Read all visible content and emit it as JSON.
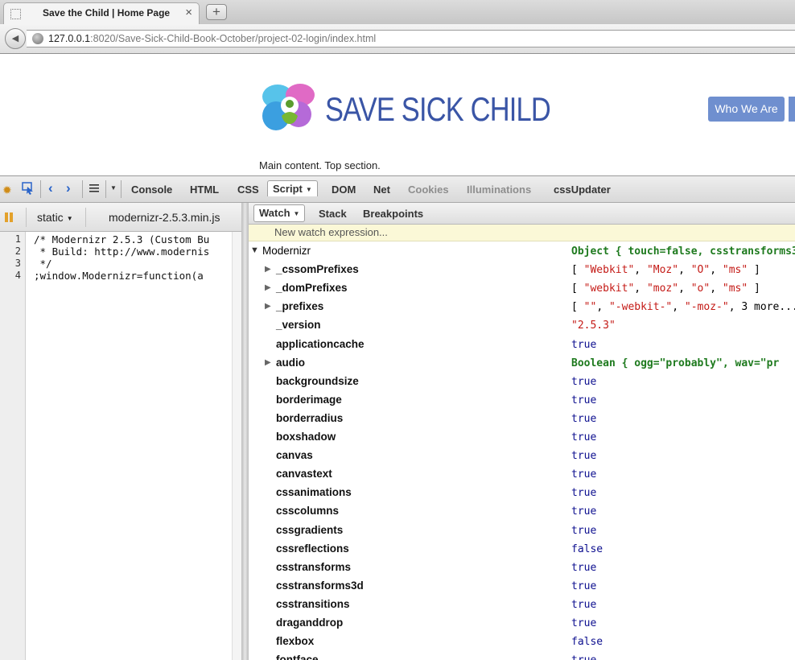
{
  "browser": {
    "tab_title": "Save the Child | Home Page",
    "tab_close": "×",
    "new_tab": "+",
    "back_glyph": "◀",
    "url_host": "127.0.0.1",
    "url_rest": ":8020/Save-Sick-Child-Book-October/project-02-login/index.html"
  },
  "page": {
    "logo_text": "SAVE SICK CHILD",
    "nav_button": "Who We Are",
    "main_text": "Main content. Top section."
  },
  "firebug": {
    "panel_tabs": [
      "Console",
      "HTML",
      "CSS",
      "Script",
      "DOM",
      "Net",
      "Cookies",
      "Illuminations",
      "cssUpdater"
    ],
    "active_tab": "Script",
    "dim_tabs": [
      "Cookies",
      "Illuminations"
    ],
    "script_toolbar": {
      "static_label": "static",
      "file_label": "modernizr-2.5.3.min.js"
    },
    "code_lines": [
      {
        "n": "1",
        "text": "/* Modernizr 2.5.3 (Custom Bu"
      },
      {
        "n": "2",
        "text": " * Build: http://www.modernis"
      },
      {
        "n": "3",
        "text": " */"
      },
      {
        "n": "4",
        "text": ";window.Modernizr=function(a"
      }
    ],
    "watch_tabs": [
      "Watch",
      "Stack",
      "Breakpoints"
    ],
    "new_watch_placeholder": "New watch expression...",
    "watch_root": {
      "name": "Modernizr",
      "value": "Object { touch=false,  csstransforms3"
    },
    "watch_rows": [
      {
        "name": "_cssomPrefixes",
        "expandable": true,
        "type": "arr",
        "value": [
          "\"Webkit\"",
          "\"Moz\"",
          "\"O\"",
          "\"ms\""
        ]
      },
      {
        "name": "_domPrefixes",
        "expandable": true,
        "type": "arr",
        "value": [
          "\"webkit\"",
          "\"moz\"",
          "\"o\"",
          "\"ms\""
        ]
      },
      {
        "name": "_prefixes",
        "expandable": true,
        "type": "arr",
        "value": [
          "\"\"",
          "\"-webkit-\"",
          "\"-moz-\""
        ],
        "more": "3 more..."
      },
      {
        "name": "_version",
        "expandable": false,
        "type": "str",
        "value": "\"2.5.3\""
      },
      {
        "name": "applicationcache",
        "expandable": false,
        "type": "bool",
        "value": "true"
      },
      {
        "name": "audio",
        "expandable": true,
        "type": "obj",
        "value": "Boolean { ogg=\"probably\",  wav=\"pr"
      },
      {
        "name": "backgroundsize",
        "expandable": false,
        "type": "bool",
        "value": "true"
      },
      {
        "name": "borderimage",
        "expandable": false,
        "type": "bool",
        "value": "true"
      },
      {
        "name": "borderradius",
        "expandable": false,
        "type": "bool",
        "value": "true"
      },
      {
        "name": "boxshadow",
        "expandable": false,
        "type": "bool",
        "value": "true"
      },
      {
        "name": "canvas",
        "expandable": false,
        "type": "bool",
        "value": "true"
      },
      {
        "name": "canvastext",
        "expandable": false,
        "type": "bool",
        "value": "true"
      },
      {
        "name": "cssanimations",
        "expandable": false,
        "type": "bool",
        "value": "true"
      },
      {
        "name": "csscolumns",
        "expandable": false,
        "type": "bool",
        "value": "true"
      },
      {
        "name": "cssgradients",
        "expandable": false,
        "type": "bool",
        "value": "true"
      },
      {
        "name": "cssreflections",
        "expandable": false,
        "type": "bool",
        "value": "false"
      },
      {
        "name": "csstransforms",
        "expandable": false,
        "type": "bool",
        "value": "true"
      },
      {
        "name": "csstransforms3d",
        "expandable": false,
        "type": "bool",
        "value": "true"
      },
      {
        "name": "csstransitions",
        "expandable": false,
        "type": "bool",
        "value": "true"
      },
      {
        "name": "draganddrop",
        "expandable": false,
        "type": "bool",
        "value": "true"
      },
      {
        "name": "flexbox",
        "expandable": false,
        "type": "bool",
        "value": "false"
      },
      {
        "name": "fontface",
        "expandable": false,
        "type": "bool",
        "value": "true"
      }
    ]
  },
  "colors": {
    "logo_blue": "#3a55a6",
    "button_blue": "#6f8fcf",
    "string_red": "#c41a16",
    "bool_navy": "#0d0f8f",
    "object_green": "#1e7a1e"
  }
}
